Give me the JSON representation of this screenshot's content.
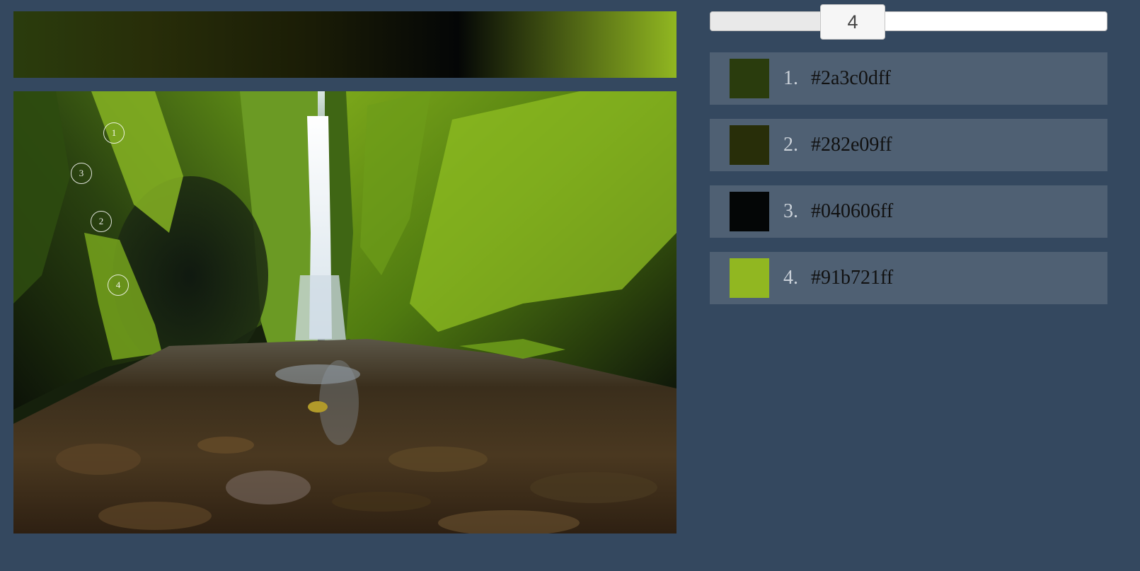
{
  "gradient": {
    "colors": [
      "#2a3c0d",
      "#282e09",
      "#1a1c06",
      "#040606",
      "#91b721"
    ]
  },
  "photo": {
    "name": "moss-canyon-waterfall-photo"
  },
  "markers": [
    {
      "label": "1"
    },
    {
      "label": "3"
    },
    {
      "label": "2"
    },
    {
      "label": "4"
    }
  ],
  "slider": {
    "value": "4",
    "min": 1,
    "max": 10
  },
  "palette": [
    {
      "index": "1.",
      "hex": "#2a3c0dff",
      "color": "#2a3c0d"
    },
    {
      "index": "2.",
      "hex": "#282e09ff",
      "color": "#282e09"
    },
    {
      "index": "3.",
      "hex": "#040606ff",
      "color": "#040606"
    },
    {
      "index": "4.",
      "hex": "#91b721ff",
      "color": "#91b721"
    }
  ]
}
